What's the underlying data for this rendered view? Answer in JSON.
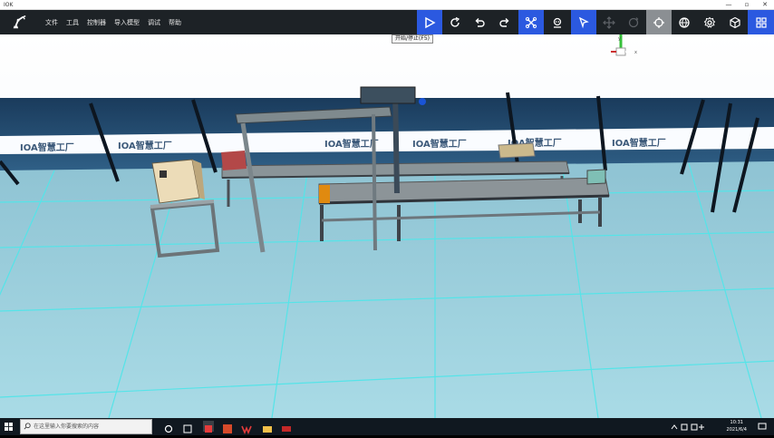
{
  "window": {
    "title": "IOK"
  },
  "menu": [
    "文件",
    "工具",
    "控制器",
    "导入模型",
    "调试",
    "帮助"
  ],
  "tooltip": "开始/停止(F5)",
  "scene": {
    "banner_text": "IOA智慧工厂"
  },
  "gizmo": {
    "y_label": "y",
    "x_label": "x"
  },
  "taskbar": {
    "search_placeholder": "在这里输入你要搜索的内容",
    "time": "10:31",
    "date": "2021/6/4"
  },
  "colors": {
    "toolbar_bg": "#1d2226",
    "accent": "#2b59e0",
    "floor": "#9fd3e0",
    "grid": "#4fe6e6",
    "wall": "#1d3f63"
  }
}
